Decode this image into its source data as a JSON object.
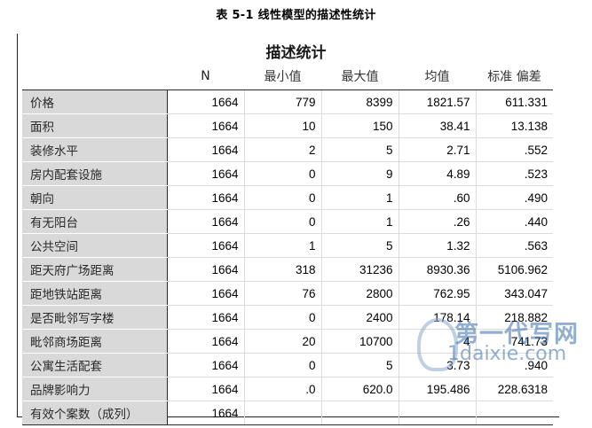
{
  "caption": "表 5-1 线性模型的描述性统计",
  "table": {
    "title": "描述统计",
    "headers": [
      "N",
      "最小值",
      "最大值",
      "均值",
      "标准 偏差"
    ],
    "rows": [
      {
        "label": "价格",
        "cells": [
          "1664",
          "779",
          "8399",
          "1821.57",
          "611.331"
        ]
      },
      {
        "label": "面积",
        "cells": [
          "1664",
          "10",
          "150",
          "38.41",
          "13.138"
        ]
      },
      {
        "label": "装修水平",
        "cells": [
          "1664",
          "2",
          "5",
          "2.71",
          ".552"
        ]
      },
      {
        "label": "房内配套设施",
        "cells": [
          "1664",
          "0",
          "9",
          "4.89",
          ".523"
        ]
      },
      {
        "label": "朝向",
        "cells": [
          "1664",
          "0",
          "1",
          ".60",
          ".490"
        ]
      },
      {
        "label": "有无阳台",
        "cells": [
          "1664",
          "0",
          "1",
          ".26",
          ".440"
        ]
      },
      {
        "label": "公共空间",
        "cells": [
          "1664",
          "1",
          "5",
          "1.32",
          ".563"
        ]
      },
      {
        "label": "距天府广场距离",
        "cells": [
          "1664",
          "318",
          "31236",
          "8930.36",
          "5106.962"
        ]
      },
      {
        "label": "距地铁站距离",
        "cells": [
          "1664",
          "76",
          "2800",
          "762.95",
          "343.047"
        ]
      },
      {
        "label": "是否毗邻写字楼",
        "cells": [
          "1664",
          "0",
          "2400",
          "178.14",
          "218.882"
        ]
      },
      {
        "label": "毗邻商场距离",
        "cells": [
          "1664",
          "20",
          "10700",
          "4",
          "741.73"
        ]
      },
      {
        "label": "公寓生活配套",
        "cells": [
          "1664",
          "0",
          "5",
          "3.73",
          ".940"
        ]
      },
      {
        "label": "品牌影响力",
        "cells": [
          "1664",
          ".0",
          "620.0",
          "195.486",
          "228.6318"
        ]
      },
      {
        "label": "有效个案数（成列）",
        "cells": [
          "1664",
          "",
          "",
          "",
          ""
        ]
      }
    ]
  },
  "watermark": {
    "line1": "第一代写网",
    "line2": "1daixie.com"
  }
}
